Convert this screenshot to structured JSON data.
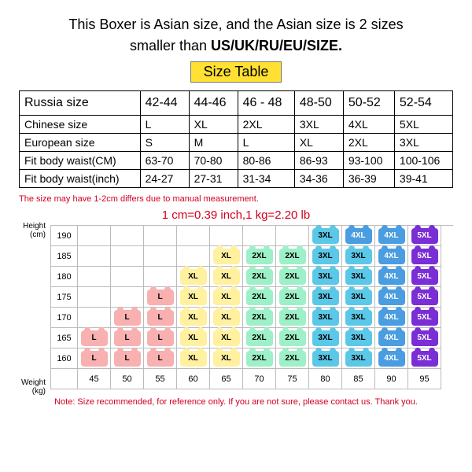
{
  "intro": {
    "line1a": "This Boxer is Asian size, and the Asian size is 2 sizes",
    "line2a": "smaller than ",
    "line2b": "US/UK/RU/EU/SIZE."
  },
  "sizeTableLabel": "Size Table",
  "table": {
    "rows": [
      [
        "Russia size",
        "42-44",
        "44-46",
        "46 - 48",
        "48-50",
        "50-52",
        "52-54"
      ],
      [
        "Chinese size",
        "L",
        "XL",
        "2XL",
        "3XL",
        "4XL",
        "5XL"
      ],
      [
        "European size",
        "S",
        "M",
        "L",
        "XL",
        "2XL",
        "3XL"
      ],
      [
        "Fit body waist(CM)",
        "63-70",
        "70-80",
        "80-86",
        "86-93",
        "93-100",
        "100-106"
      ],
      [
        "Fit body waist(inch)",
        "24-27",
        "27-31",
        "31-34",
        "34-36",
        "36-39",
        "39-41"
      ]
    ]
  },
  "disclaimer": "The size may have 1-2cm differs due to manual measurement.",
  "conversion": "1 cm=0.39 inch,1 kg=2.20 lb",
  "chart_data": {
    "type": "heatmap",
    "ylabel": "Height\n(cm)",
    "xlabel": "Weight\n(kg)",
    "heights": [
      "190",
      "185",
      "180",
      "175",
      "170",
      "165",
      "160"
    ],
    "weights": [
      "45",
      "50",
      "55",
      "60",
      "65",
      "70",
      "75",
      "80",
      "85",
      "90",
      "95"
    ],
    "grid": [
      [
        "",
        "",
        "",
        "",
        "",
        "",
        "",
        "3XL",
        "4XL",
        "4XL",
        "5XL"
      ],
      [
        "",
        "",
        "",
        "",
        "XL",
        "2XL",
        "2XL",
        "3XL",
        "3XL",
        "4XL",
        "5XL"
      ],
      [
        "",
        "",
        "",
        "XL",
        "XL",
        "2XL",
        "2XL",
        "3XL",
        "3XL",
        "4XL",
        "5XL"
      ],
      [
        "",
        "",
        "L",
        "XL",
        "XL",
        "2XL",
        "2XL",
        "3XL",
        "3XL",
        "4XL",
        "5XL"
      ],
      [
        "",
        "L",
        "L",
        "XL",
        "XL",
        "2XL",
        "2XL",
        "3XL",
        "3XL",
        "4XL",
        "5XL"
      ],
      [
        "L",
        "L",
        "L",
        "XL",
        "XL",
        "2XL",
        "2XL",
        "3XL",
        "3XL",
        "4XL",
        "5XL"
      ],
      [
        "L",
        "L",
        "L",
        "XL",
        "XL",
        "2XL",
        "2XL",
        "3XL",
        "3XL",
        "4XL",
        "5XL"
      ]
    ],
    "colors": {
      "L": "#f8b0b0",
      "XL": "#fff1a0",
      "2XL": "#9ef0c8",
      "3XL": "#5cc8e8",
      "4XL": "#4a9de0",
      "5XL": "#7a2ed6"
    }
  },
  "note2": "Note: Size recommended, for reference only. If you are not sure, please contact us. Thank you."
}
